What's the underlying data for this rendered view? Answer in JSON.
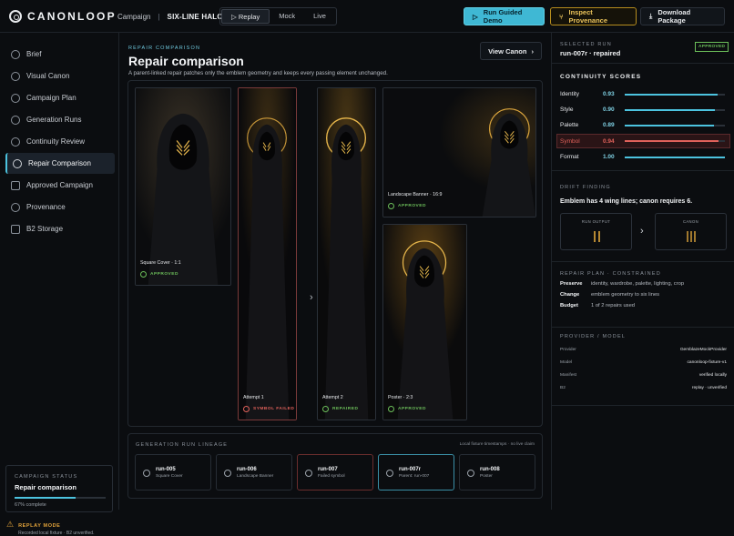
{
  "header": {
    "logo_text": "CANONLOOP",
    "breadcrumb": {
      "root": "Campaign",
      "current": "SIX-LINE HALO"
    },
    "modes": {
      "replay": "Replay",
      "mock": "Mock",
      "live": "Live"
    },
    "run_demo": "Run Guided Demo",
    "inspect": "Inspect Provenance",
    "download": "Download Package"
  },
  "sidebar": {
    "items": [
      {
        "label": "Brief"
      },
      {
        "label": "Visual Canon"
      },
      {
        "label": "Campaign Plan"
      },
      {
        "label": "Generation Runs"
      },
      {
        "label": "Continuity Review"
      },
      {
        "label": "Repair Comparison"
      },
      {
        "label": "Approved Campaign"
      },
      {
        "label": "Provenance"
      },
      {
        "label": "B2 Storage"
      }
    ],
    "status": {
      "caption": "CAMPAIGN STATUS",
      "title": "Repair comparison",
      "progress_pct": 67,
      "progress_text": "67% complete"
    },
    "replay": {
      "title": "REPLAY MODE",
      "text": "Recorded local fixture · B2 unverified."
    }
  },
  "main": {
    "caption": "REPAIR COMPARISON",
    "title": "Repair comparison",
    "subtitle": "A parent-linked repair patches only the emblem geometry and keeps every passing element unchanged.",
    "view_canon": "View Canon",
    "images": {
      "square": {
        "label": "Square Cover · 1:1",
        "status": "APPROVED"
      },
      "attempt1": {
        "label": "Attempt 1",
        "status": "SYMBOL FAILED"
      },
      "attempt2": {
        "label": "Attempt 2",
        "status": "REPAIRED"
      },
      "landscape": {
        "label": "Landscape Banner · 16:9",
        "status": "APPROVED"
      },
      "poster": {
        "label": "Poster · 2:3",
        "status": "APPROVED"
      }
    },
    "lineage": {
      "caption": "GENERATION RUN LINEAGE",
      "note": "Local fixture timestamps · no live claim",
      "runs": [
        {
          "id": "run-005",
          "desc": "Square Cover"
        },
        {
          "id": "run-006",
          "desc": "Landscape Banner"
        },
        {
          "id": "run-007",
          "desc": "Failed symbol"
        },
        {
          "id": "run-007r",
          "desc": "Parent: run-007"
        },
        {
          "id": "run-008",
          "desc": "Poster"
        }
      ]
    }
  },
  "right": {
    "selected_caption": "SELECTED RUN",
    "selected_run": "run-007r · repaired",
    "badge": "APPROVED",
    "scores_caption": "CONTINUITY SCORES",
    "scores": [
      {
        "name": "Identity",
        "value": "0.93",
        "fraction": 0.93
      },
      {
        "name": "Style",
        "value": "0.90",
        "fraction": 0.9
      },
      {
        "name": "Palette",
        "value": "0.89",
        "fraction": 0.89
      },
      {
        "name": "Symbol",
        "value": "0.94",
        "fraction": 0.94
      },
      {
        "name": "Format",
        "value": "1.00",
        "fraction": 1.0
      }
    ],
    "drift_caption": "DRIFT FINDING",
    "drift_text": "Emblem has 4 wing lines; canon requires 6.",
    "run_output_label": "RUN OUTPUT",
    "canon_label": "CANON",
    "repair_caption": "REPAIR PLAN · CONSTRAINED",
    "repair": {
      "preserve_k": "Preserve",
      "preserve_v": "identity, wardrobe, palette, lighting, crop",
      "change_k": "Change",
      "change_v": "emblem geometry to six lines",
      "budget_k": "Budget",
      "budget_v": "1 of 2 repairs used"
    },
    "provider_caption": "PROVIDER / MODEL",
    "provider_rows": [
      {
        "k": "Provider",
        "v": "GemblazeMockProvider"
      },
      {
        "k": "Model",
        "v": "canonloop-fixture-v1"
      },
      {
        "k": "Manifest",
        "v": "verified locally"
      },
      {
        "k": "B2",
        "v": "replay · unverified"
      }
    ]
  }
}
